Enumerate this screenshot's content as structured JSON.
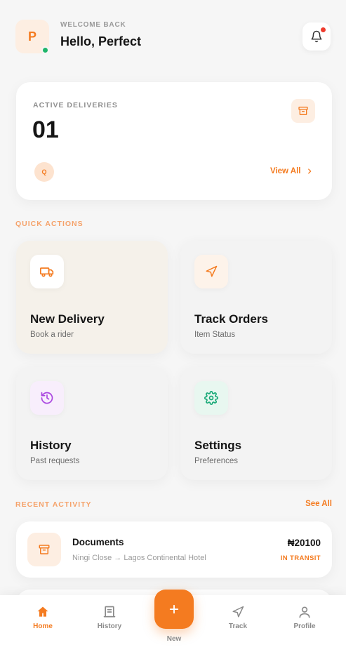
{
  "header": {
    "avatar_initial": "P",
    "welcome": "WELCOME BACK",
    "greeting": "Hello, Perfect",
    "notification_icon": "bell-icon"
  },
  "active_deliveries": {
    "label": "ACTIVE DELIVERIES",
    "count": "01",
    "chip": "Q",
    "view_all": "View All",
    "icon": "archive-box-icon"
  },
  "quick_actions": {
    "label": "QUICK ACTIONS",
    "items": [
      {
        "title": "New Delivery",
        "subtitle": "Book a rider",
        "icon": "truck-icon"
      },
      {
        "title": "Track Orders",
        "subtitle": "Item Status",
        "icon": "navigation-arrow-icon"
      },
      {
        "title": "History",
        "subtitle": "Past requests",
        "icon": "history-clock-icon"
      },
      {
        "title": "Settings",
        "subtitle": "Preferences",
        "icon": "gear-icon"
      }
    ]
  },
  "recent_activity": {
    "label": "RECENT ACTIVITY",
    "see_all": "See All",
    "items": [
      {
        "title": "Documents",
        "route": "Ningi Close → Lagos Continental Hotel",
        "price": "₦20100",
        "status": "IN TRANSIT",
        "icon": "archive-box-icon"
      }
    ]
  },
  "bottom_nav": {
    "items": [
      {
        "label": "Home",
        "icon": "home-icon",
        "active": true
      },
      {
        "label": "History",
        "icon": "receipt-icon",
        "active": false
      },
      {
        "label": "New",
        "icon": "plus-icon",
        "active": false
      },
      {
        "label": "Track",
        "icon": "navigation-arrow-icon",
        "active": false
      },
      {
        "label": "Profile",
        "icon": "user-icon",
        "active": false
      }
    ]
  },
  "colors": {
    "accent": "#f47b20",
    "online": "#1fb56a",
    "alert": "#ef3b2d",
    "history_icon": "#a944e0",
    "settings_icon": "#17a876"
  }
}
